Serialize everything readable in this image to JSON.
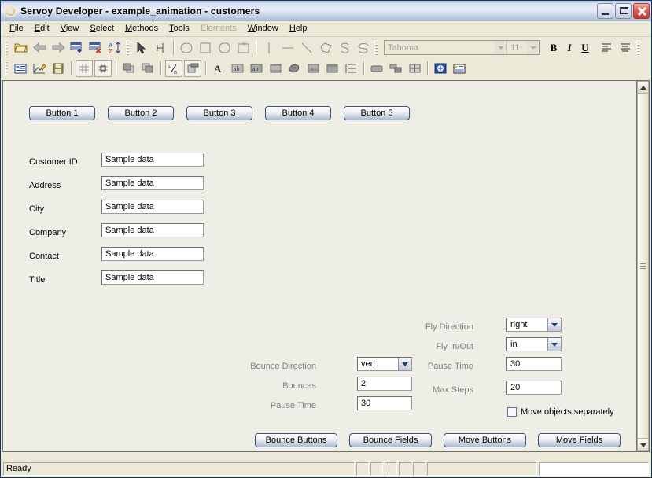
{
  "window": {
    "title": "Servoy Developer - example_animation - customers",
    "icon": "app-icon",
    "controls": [
      {
        "name": "minimize-button",
        "glyph": "minimize"
      },
      {
        "name": "maximize-button",
        "glyph": "maximize"
      },
      {
        "name": "close-button",
        "glyph": "close"
      }
    ]
  },
  "menubar": [
    {
      "label": "File",
      "mnemonic": "F",
      "disabled": false
    },
    {
      "label": "Edit",
      "mnemonic": "E",
      "disabled": false
    },
    {
      "label": "View",
      "mnemonic": "V",
      "disabled": false
    },
    {
      "label": "Select",
      "mnemonic": "S",
      "disabled": false
    },
    {
      "label": "Methods",
      "mnemonic": "M",
      "disabled": false
    },
    {
      "label": "Tools",
      "mnemonic": "T",
      "disabled": false
    },
    {
      "label": "Elements",
      "mnemonic": "",
      "disabled": true
    },
    {
      "label": "Window",
      "mnemonic": "W",
      "disabled": false
    },
    {
      "label": "Help",
      "mnemonic": "H",
      "disabled": false
    }
  ],
  "toolbar_row1": {
    "icons": [
      "open-folder-icon",
      "back-arrow-icon",
      "forward-arrow-icon",
      "add-record-icon",
      "delete-record-icon",
      "sort-az-icon",
      "pointer-icon",
      "anchor-icon",
      "circle-icon",
      "square-icon",
      "rounded-rect-icon",
      "template-icon",
      "vertical-line-icon",
      "horizontal-line-icon",
      "diagonal-line-icon",
      "polygon-icon",
      "curve-icon",
      "freehand-icon"
    ],
    "font": {
      "name": "Tahoma",
      "size": "11",
      "name_field": "font-name-combo",
      "size_field": "font-size-combo"
    },
    "text_buttons": [
      {
        "name": "bold-button",
        "label": "B"
      },
      {
        "name": "italic-button",
        "label": "I"
      },
      {
        "name": "underline-button",
        "label": "U"
      },
      {
        "name": "align-left-button",
        "label": "align-left"
      },
      {
        "name": "align-center-button",
        "label": "align-center"
      }
    ]
  },
  "toolbar_row2": {
    "icons": [
      "form-editor-icon",
      "design-chart-icon",
      "save-icon",
      "grid-icon",
      "snap-grid-icon",
      "bring-front-icon",
      "send-back-icon",
      "fraction-icon",
      "tab-sequence-icon",
      "text-label-icon",
      "text-field-icon",
      "text-area-icon",
      "list-box-icon",
      "check-field-icon",
      "image-field-icon",
      "portal-icon",
      "tab-panel-icon",
      "button-icon",
      "button-image-icon",
      "table-view-icon",
      "flag-icon",
      "record-view-icon"
    ]
  },
  "form": {
    "buttons_row": [
      {
        "name": "form-button-1",
        "label": "Button 1"
      },
      {
        "name": "form-button-2",
        "label": "Button 2"
      },
      {
        "name": "form-button-3",
        "label": "Button 3"
      },
      {
        "name": "form-button-4",
        "label": "Button 4"
      },
      {
        "name": "form-button-5",
        "label": "Button 5"
      }
    ],
    "fields": [
      {
        "name": "customer-id",
        "label": "Customer ID",
        "value": "Sample data"
      },
      {
        "name": "address",
        "label": "Address",
        "value": "Sample data"
      },
      {
        "name": "city",
        "label": "City",
        "value": "Sample data"
      },
      {
        "name": "company",
        "label": "Company",
        "value": "Sample data"
      },
      {
        "name": "contact",
        "label": "Contact",
        "value": "Sample data"
      },
      {
        "name": "title",
        "label": "Title",
        "value": "Sample data"
      }
    ],
    "bounce_panel": [
      {
        "name": "bounce-direction",
        "label": "Bounce Direction",
        "value": "vert",
        "type": "combo"
      },
      {
        "name": "bounces",
        "label": "Bounces",
        "value": "2",
        "type": "field"
      },
      {
        "name": "bounce-pause-time",
        "label": "Pause Time",
        "value": "30",
        "type": "field"
      }
    ],
    "fly_panel": [
      {
        "name": "fly-direction",
        "label": "Fly Direction",
        "value": "right",
        "type": "combo"
      },
      {
        "name": "fly-in-out",
        "label": "Fly In/Out",
        "value": "in",
        "type": "combo"
      },
      {
        "name": "fly-pause-time",
        "label": "Pause Time",
        "value": "30",
        "type": "field"
      },
      {
        "name": "max-steps",
        "label": "Max Steps",
        "value": "20",
        "type": "field"
      }
    ],
    "checkbox": {
      "name": "move-objects-separately",
      "label": "Move objects separately",
      "checked": false
    },
    "action_buttons": [
      {
        "name": "bounce-buttons-button",
        "label": "Bounce Buttons"
      },
      {
        "name": "bounce-fields-button",
        "label": "Bounce Fields"
      },
      {
        "name": "move-buttons-button",
        "label": "Move Buttons"
      },
      {
        "name": "move-fields-button",
        "label": "Move Fields"
      }
    ]
  },
  "statusbar": {
    "message": "Ready"
  },
  "colors": {
    "titlebar_text": "#000000",
    "canvas_bg": "#eeeee6",
    "chrome_bg": "#ece9d8",
    "button_border": "#33557e",
    "gray_label": "#7f7f7f"
  }
}
